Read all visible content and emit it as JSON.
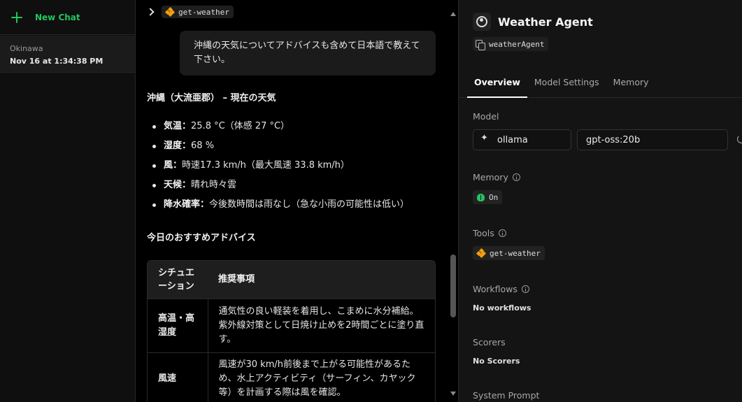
{
  "sidebar": {
    "new_chat_label": "New Chat",
    "thread": {
      "title": "Okinawa",
      "timestamp": "Nov 16 at 1:34:38 PM"
    }
  },
  "chat": {
    "tool_call": {
      "name": "get-weather"
    },
    "user_message": "沖縄の天気についてアドバイスも含めて日本語で教えて下さい。",
    "response": {
      "title": "沖縄（大流亜郡） – 現在の天気",
      "items": [
        {
          "label": "気温：",
          "value": "25.8 °C（体感 27 °C）"
        },
        {
          "label": "湿度：",
          "value": "68 %"
        },
        {
          "label": "風：",
          "value": "時速17.3 km/h（最大風速 33.8 km/h）"
        },
        {
          "label": "天候：",
          "value": "晴れ時々雲"
        },
        {
          "label": "降水確率：",
          "value": "今後数時間は雨なし（急な小雨の可能性は低い）"
        }
      ],
      "advice_title": "今日のおすすめアドバイス",
      "table": {
        "headers": [
          "シチュエーション",
          "推奨事項"
        ],
        "rows": [
          {
            "situation": "高温・高湿度",
            "advice": "通気性の良い軽装を着用し、こまめに水分補給。紫外線対策として日焼け止めを2時間ごとに塗り直す。"
          },
          {
            "situation": "風速",
            "advice": "風速が30 km/h前後まで上がる可能性があるため、水上アクティビティ（サーフィン、カヤック等）を計画する際は風を確認。"
          }
        ]
      }
    }
  },
  "agent": {
    "name": "Weather Agent",
    "id": "weatherAgent",
    "tabs": [
      "Overview",
      "Model Settings",
      "Memory"
    ],
    "active_tab": "Overview",
    "model": {
      "label": "Model",
      "provider": "ollama",
      "name": "gpt-oss:20b"
    },
    "memory": {
      "label": "Memory",
      "status": "On"
    },
    "tools": {
      "label": "Tools",
      "items": [
        "get-weather"
      ]
    },
    "workflows": {
      "label": "Workflows",
      "value": "No workflows"
    },
    "scorers": {
      "label": "Scorers",
      "value": "No Scorers"
    },
    "system_prompt": {
      "label": "System Prompt"
    }
  },
  "colors": {
    "accent_green": "#22c55e",
    "tool_orange": "#f59e0b"
  }
}
